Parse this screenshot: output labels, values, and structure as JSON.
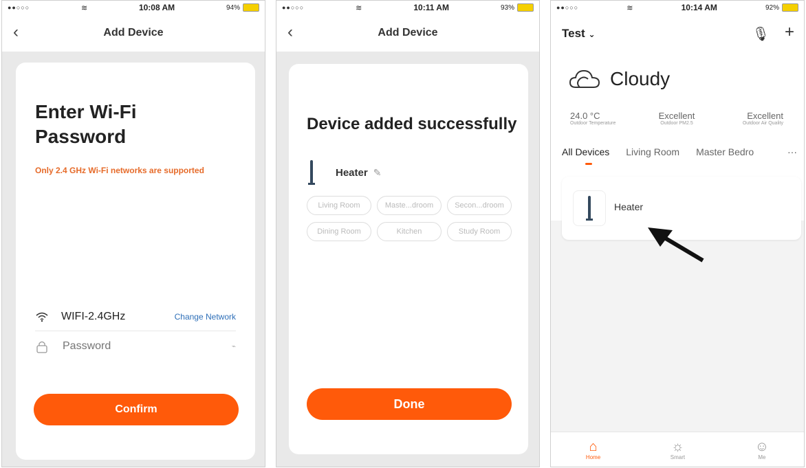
{
  "status_bars": [
    {
      "signal": "●●○○○",
      "time": "10:08 AM",
      "battery": "94%"
    },
    {
      "signal": "●●○○○",
      "time": "10:11 AM",
      "battery": "93%"
    },
    {
      "signal": "●●○○○",
      "time": "10:14 AM",
      "battery": "92%"
    }
  ],
  "screen1": {
    "nav_title": "Add Device",
    "title_line1": "Enter Wi-Fi",
    "title_line2": "Password",
    "warning": "Only 2.4 GHz Wi-Fi networks are supported",
    "wifi_name": "WIFI-2.4GHz",
    "change_network": "Change Network",
    "password_placeholder": "Password",
    "confirm": "Confirm"
  },
  "screen2": {
    "nav_title": "Add Device",
    "title": "Device added successfully",
    "device_name": "Heater",
    "rooms": [
      "Living Room",
      "Maste...droom",
      "Secon...droom",
      "Dining Room",
      "Kitchen",
      "Study Room"
    ],
    "done": "Done"
  },
  "screen3": {
    "home": "Test",
    "weather": "Cloudy",
    "stats": [
      {
        "value": "24.0 °C",
        "label": "Outdoor Temperature"
      },
      {
        "value": "Excellent",
        "label": "Outdoor PM2.5"
      },
      {
        "value": "Excellent",
        "label": "Outdoor Air Quality"
      }
    ],
    "tabs": [
      "All Devices",
      "Living Room",
      "Master Bedro"
    ],
    "more": "···",
    "device": "Heater",
    "tabbar": [
      "Home",
      "Smart",
      "Me"
    ]
  },
  "colors": {
    "accent": "#ff5a0a",
    "warning": "#e66b2a",
    "link": "#2e6fb8"
  }
}
